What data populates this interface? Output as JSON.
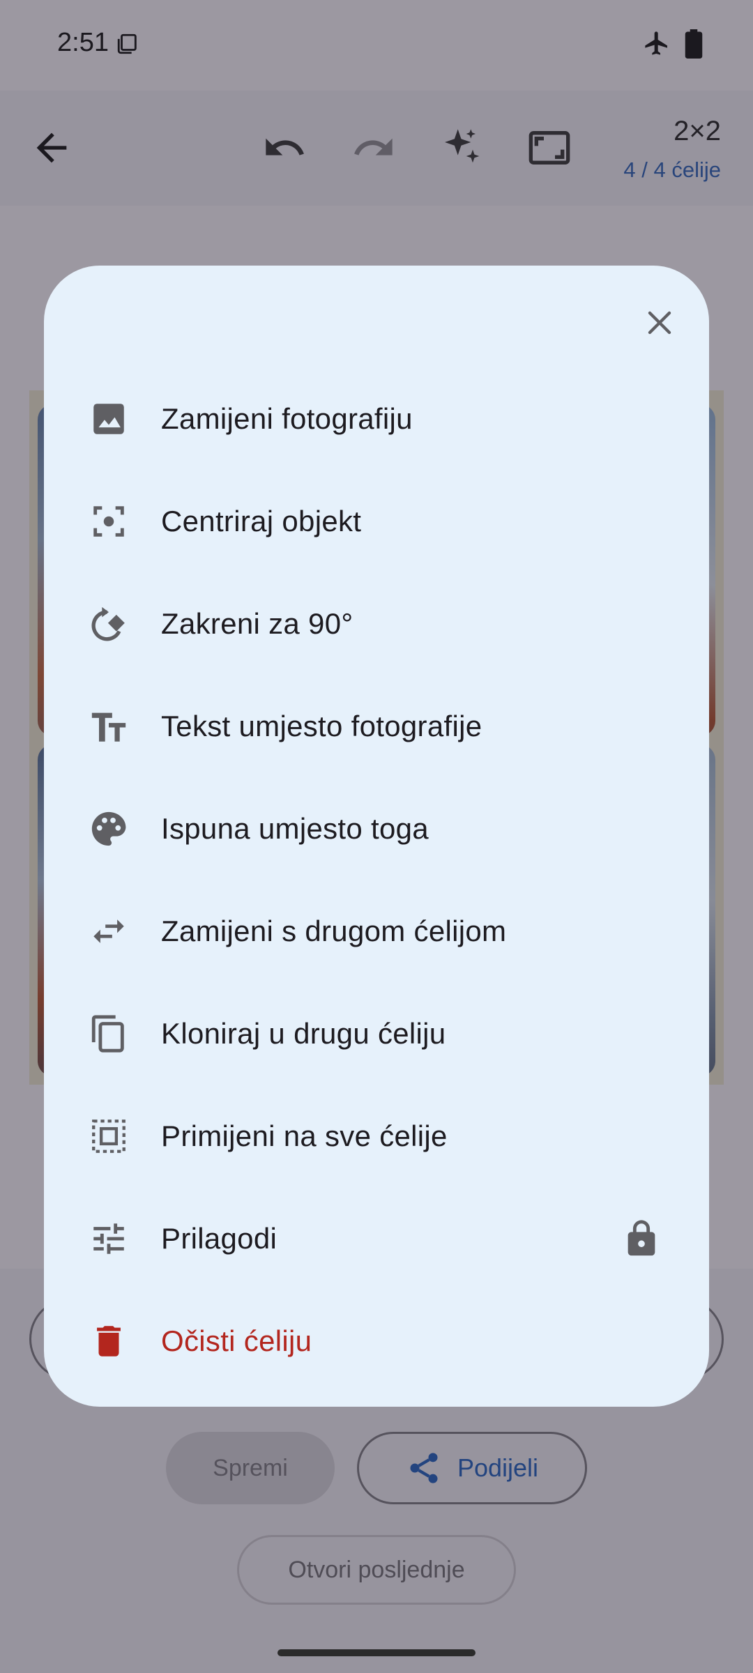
{
  "status_bar": {
    "time": "2:51"
  },
  "toolbar": {
    "grid_size": "2×2",
    "cells_filled": "4 / 4 ćelije"
  },
  "bottom": {
    "save_label": "Spremi",
    "share_label": "Podijeli",
    "open_last_label": "Otvori posljednje"
  },
  "dialog": {
    "items": [
      {
        "label": "Zamijeni fotografiju",
        "icon": "image-icon"
      },
      {
        "label": "Centriraj objekt",
        "icon": "center-focus-icon"
      },
      {
        "label": "Zakreni za 90°",
        "icon": "rotate-icon"
      },
      {
        "label": "Tekst umjesto fotografije",
        "icon": "text-fields-icon"
      },
      {
        "label": "Ispuna umjesto toga",
        "icon": "palette-icon"
      },
      {
        "label": "Zamijeni s drugom ćelijom",
        "icon": "swap-icon"
      },
      {
        "label": "Kloniraj u drugu ćeliju",
        "icon": "copy-icon"
      },
      {
        "label": "Primijeni na sve ćelije",
        "icon": "select-all-icon"
      },
      {
        "label": "Prilagodi",
        "icon": "tune-icon",
        "locked": true
      },
      {
        "label": "Očisti ćeliju",
        "icon": "delete-icon",
        "danger": true
      }
    ]
  },
  "colors": {
    "dialog_bg": "#e6f1fb",
    "danger": "#b3261e",
    "accent": "#2a62b8",
    "icon_gray": "#5f5f63"
  }
}
